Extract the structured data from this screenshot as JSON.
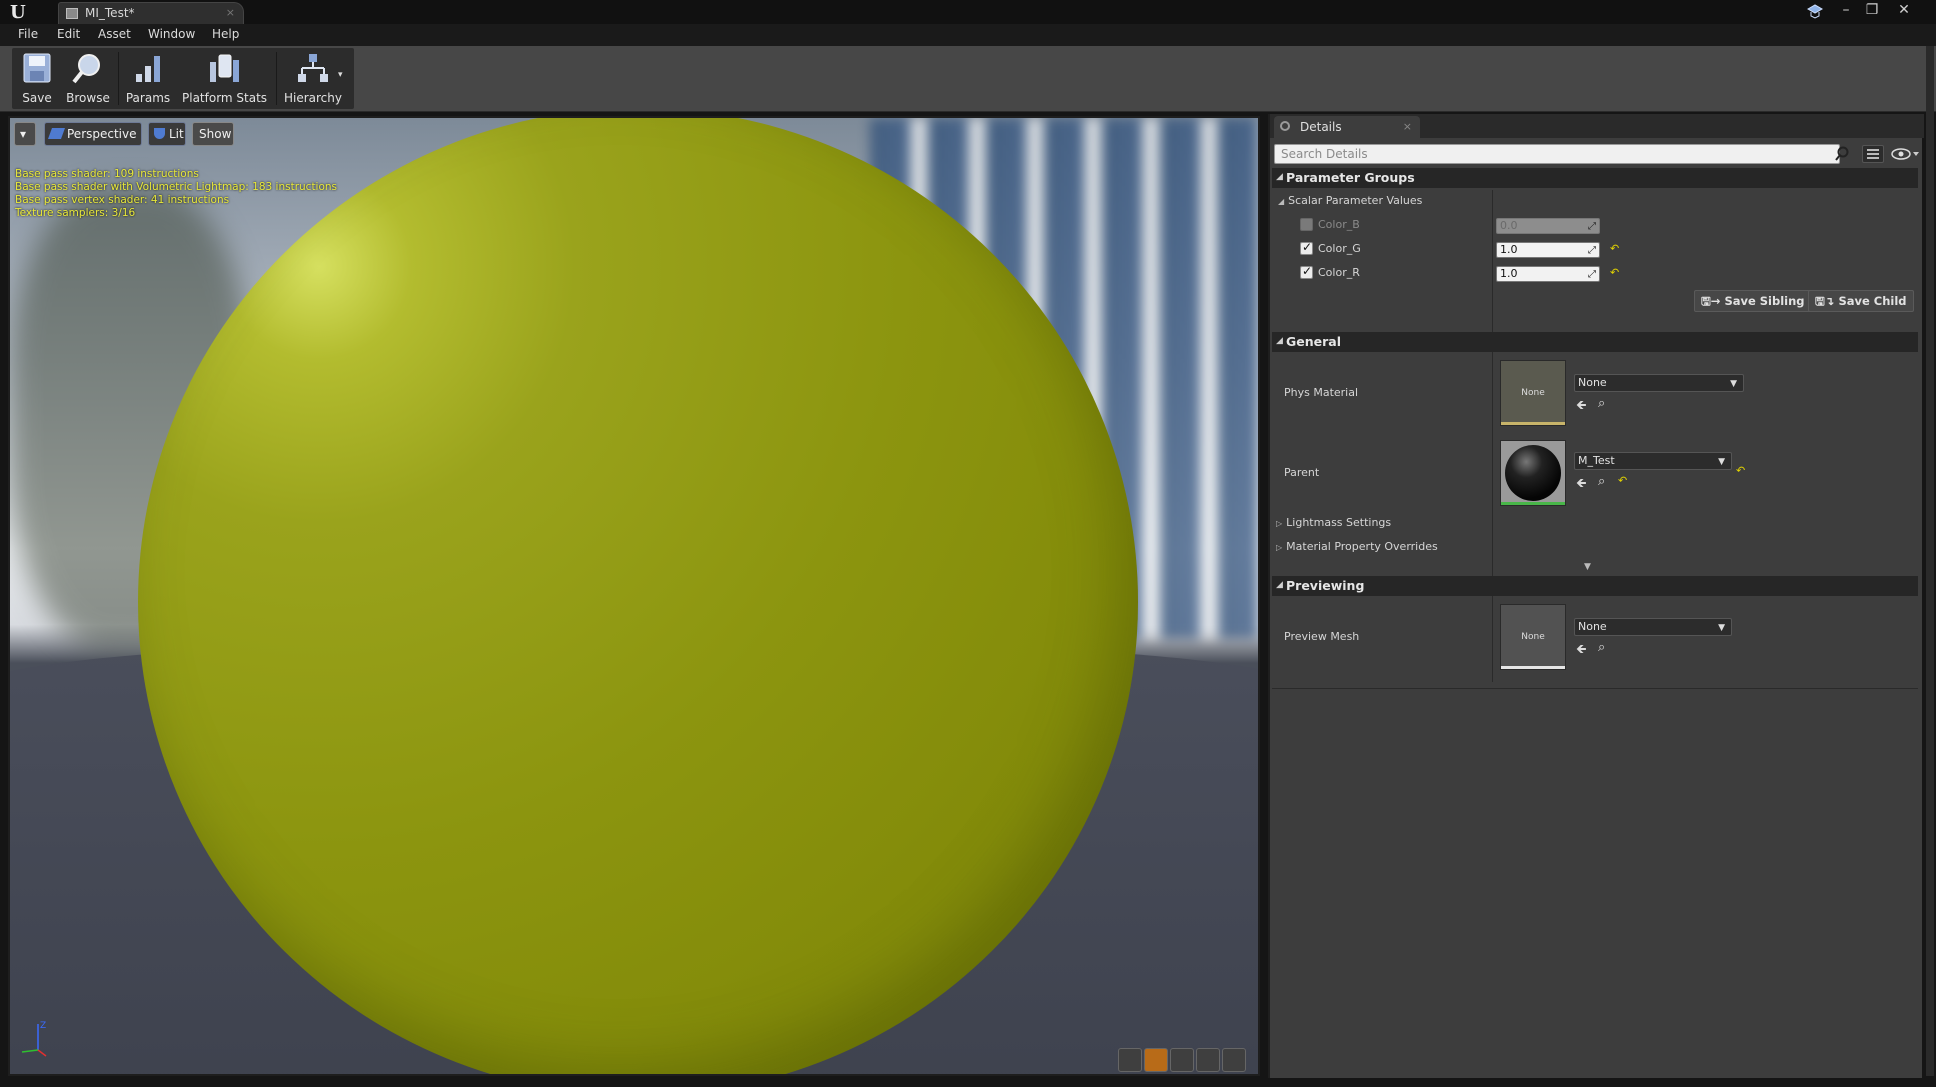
{
  "window": {
    "tab_title": "MI_Test*",
    "tab_close": "×",
    "controls": {
      "minimize": "–",
      "restore": "❐",
      "close": "✕"
    },
    "logo": "U"
  },
  "menu": [
    "File",
    "Edit",
    "Asset",
    "Window",
    "Help"
  ],
  "toolbar": {
    "save": "Save",
    "browse": "Browse",
    "params": "Params",
    "platform_stats": "Platform Stats",
    "hierarchy": "Hierarchy"
  },
  "viewport": {
    "menu_caret": "▾",
    "perspective": "Perspective",
    "lit": "Lit",
    "show": "Show",
    "stats": [
      "Base pass shader: 109 instructions",
      "Base pass shader with Volumetric Lightmap: 183 instructions",
      "Base pass vertex shader: 41 instructions",
      "Texture samplers: 3/16"
    ],
    "axis_z": "Z",
    "sphere_color": "#8c950f"
  },
  "details": {
    "tab": "Details",
    "tab_close": "×",
    "search_placeholder": "Search Details",
    "parameter_groups": {
      "header": "Parameter Groups",
      "scalar_header": "Scalar Parameter Values",
      "params": [
        {
          "name": "Color_B",
          "value": "0.0",
          "enabled": false
        },
        {
          "name": "Color_G",
          "value": "1.0",
          "enabled": true
        },
        {
          "name": "Color_R",
          "value": "1.0",
          "enabled": true
        }
      ],
      "save_sibling": "Save Sibling",
      "save_child": "Save Child"
    },
    "general": {
      "header": "General",
      "phys_material_label": "Phys Material",
      "phys_material_thumb": "None",
      "phys_material_value": "None",
      "parent_label": "Parent",
      "parent_value": "M_Test",
      "lightmass": "Lightmass Settings",
      "material_overrides": "Material Property Overrides"
    },
    "previewing": {
      "header": "Previewing",
      "preview_mesh_label": "Preview Mesh",
      "preview_mesh_thumb": "None",
      "preview_mesh_value": "None"
    }
  }
}
